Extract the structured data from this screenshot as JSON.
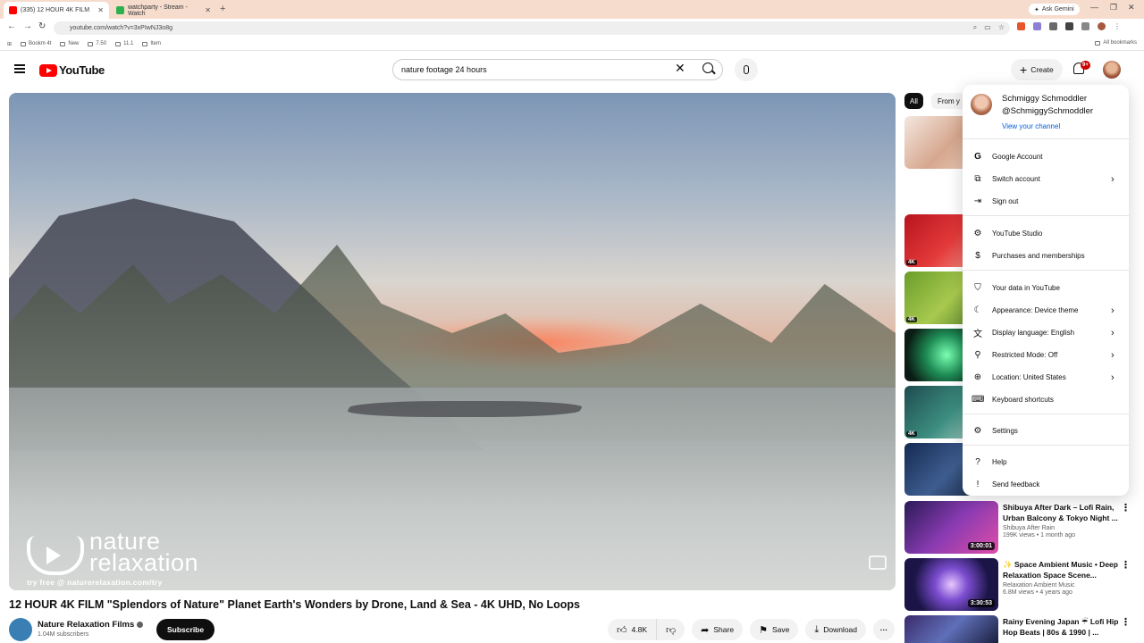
{
  "browser": {
    "tabs": [
      {
        "title": "(335) 12 HOUR 4K FILM",
        "active": true
      },
      {
        "title": "watchparty - Stream - Watch",
        "active": false
      }
    ],
    "new_tab": "+",
    "ask_gemini": "Ask Gemini",
    "url": "youtube.com/watch?v=3xPIwNJ3o8g",
    "bookmarks": [
      "Bookm 4t",
      "New",
      "7.50",
      "11.1",
      "Item"
    ],
    "all_bookmarks": "All bookmarks"
  },
  "youtube": {
    "logo_text": "YouTube",
    "search_value": "nature footage 24 hours",
    "create_label": "Create",
    "notification_count": "9+"
  },
  "player": {
    "watermark_line1": "nature",
    "watermark_line2": "relaxation",
    "watermark_try": "try free @ naturerelaxation.com/try"
  },
  "video": {
    "title": "12 HOUR 4K FILM \"Splendors of Nature\" Planet Earth's Wonders by Drone, Land & Sea - 4K UHD, No Loops",
    "channel": "Nature Relaxation Films",
    "subscribers": "1.04M subscribers",
    "subscribe_label": "Subscribe",
    "likes": "4.8K",
    "share_label": "Share",
    "save_label": "Save",
    "download_label": "Download"
  },
  "filters": {
    "all": "All",
    "from": "From y"
  },
  "recommendations": [
    {
      "title": "Shibuya After Dark – Lofi Rain, Urban Balcony & Tokyo Night ...",
      "channel": "Shibuya After Rain",
      "stats": "199K views • 1 month ago",
      "duration": "3:00:01"
    },
    {
      "title": "✨ Space Ambient Music • Deep Relaxation Space Scene...",
      "channel": "Relaxation Ambient Music",
      "stats": "6.8M views • 4 years ago",
      "duration": "3:30:53"
    },
    {
      "title": "Rainy Evening Japan ☔ Lofi Hip Hop Beats | 80s & 1990 | ...",
      "channel": "",
      "stats": "",
      "duration": ""
    }
  ],
  "account_menu": {
    "name": "Schmiggy Schmoddler",
    "handle": "@SchmiggySchmoddler",
    "view_channel": "View your channel",
    "items": [
      "Google Account",
      "Switch account",
      "Sign out",
      "YouTube Studio",
      "Purchases and memberships",
      "Your data in YouTube",
      "Appearance: Device theme",
      "Display language: English",
      "Restricted Mode: Off",
      "Location: United States",
      "Keyboard shortcuts",
      "Settings",
      "Help",
      "Send feedback"
    ]
  },
  "colors": {
    "brand_red": "#ff0000",
    "link_blue": "#065fd4",
    "badge_red": "#cc0000"
  }
}
